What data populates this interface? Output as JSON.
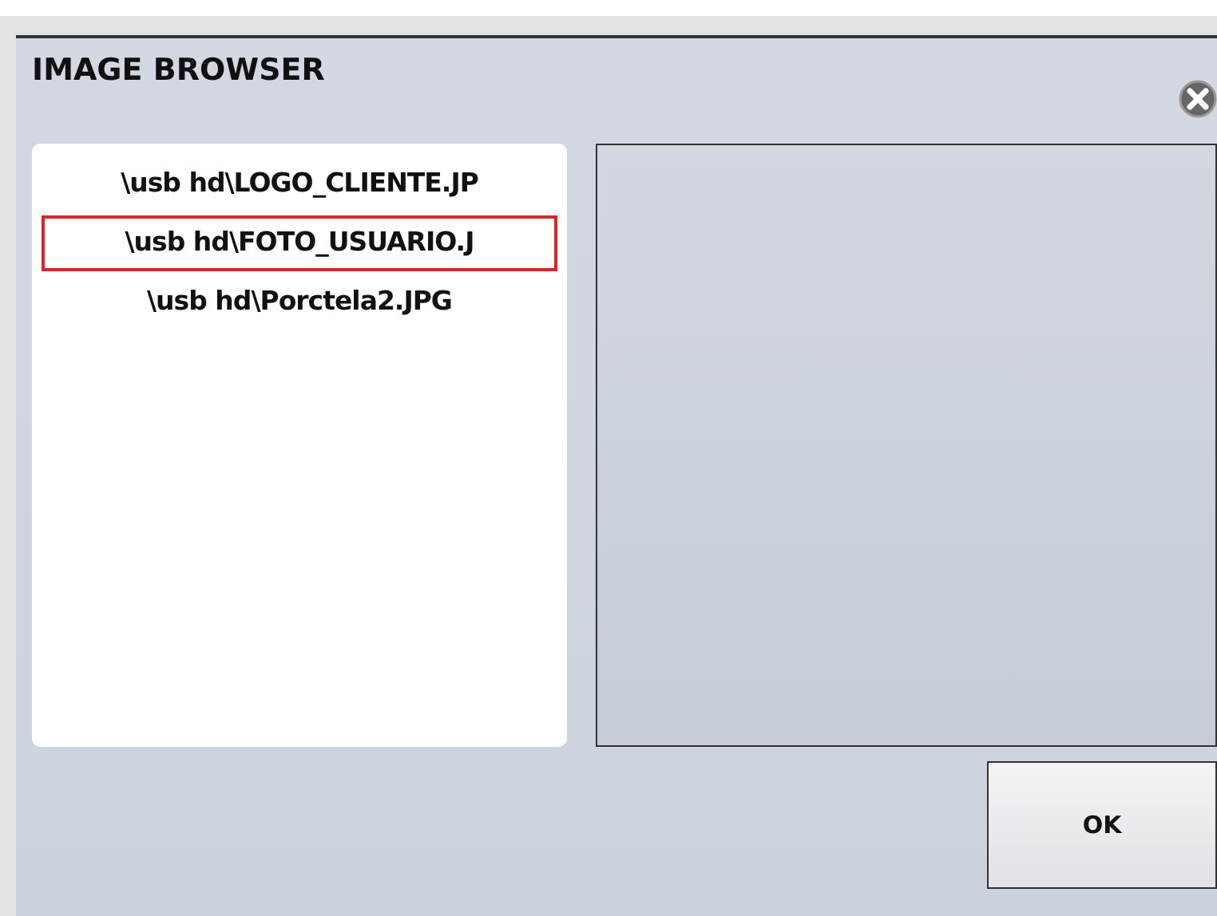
{
  "window": {
    "title": "IMAGE BROWSER"
  },
  "files": [
    {
      "label": "\\usb hd\\LOGO_CLIENTE.JP",
      "selected": false
    },
    {
      "label": "\\usb hd\\FOTO_USUARIO.J",
      "selected": true
    },
    {
      "label": "\\usb hd\\Porctela2.JPG",
      "selected": false
    }
  ],
  "buttons": [
    {
      "label": "OK"
    }
  ]
}
